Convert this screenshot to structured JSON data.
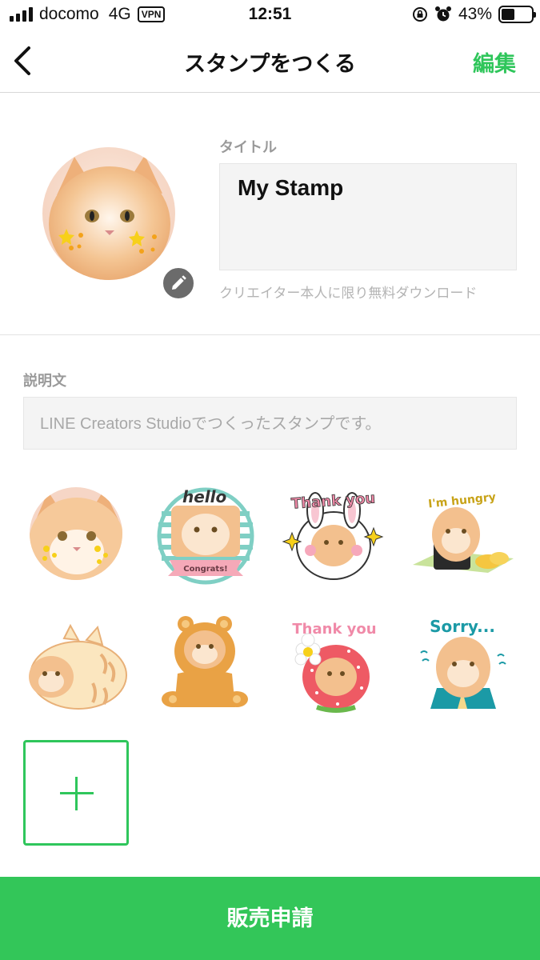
{
  "status_bar": {
    "carrier": "docomo",
    "network": "4G",
    "vpn": "VPN",
    "time": "12:51",
    "battery": "43%",
    "battery_level": 0.43
  },
  "nav": {
    "title": "スタンプをつくる",
    "edit": "編集"
  },
  "header": {
    "title_label": "タイトル",
    "title_value": "My Stamp",
    "note": "クリエイター本人に限り無料ダウンロード"
  },
  "description": {
    "label": "説明文",
    "placeholder": "LINE Creators Studioでつくったスタンプです。"
  },
  "stickers": {
    "hello": "hello",
    "congrats": "Congrats!",
    "thank_you_1": "Thank you",
    "hungry": "I'm hungry",
    "thank_you_2": "Thank you",
    "sorry": "Sorry..."
  },
  "submit": {
    "label": "販売申請"
  },
  "colors": {
    "accent": "#33c659",
    "edit_text": "#2fc65b"
  }
}
